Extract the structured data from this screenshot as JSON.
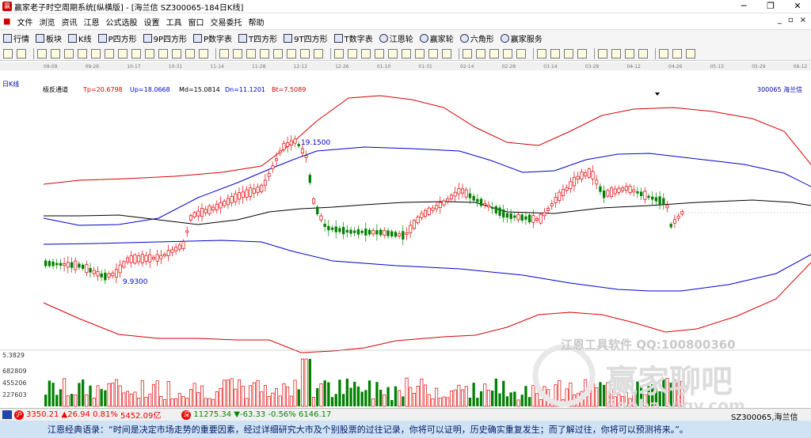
{
  "window": {
    "title": "赢家老子时空周期系统[纵横版] - [海兰信  SZ300065-184日K线]"
  },
  "menu": [
    "文件",
    "浏览",
    "资讯",
    "江恩",
    "公式选股",
    "设置",
    "工具",
    "窗口",
    "交易委托",
    "帮助"
  ],
  "toolbar1": [
    "行情",
    "板块",
    "K线",
    "P四方形",
    "9P四方形",
    "P数字表",
    "T四方形",
    "9T四方形",
    "T数字表",
    "江恩轮",
    "赢家轮",
    "六角形",
    "赢家服务"
  ],
  "chart": {
    "period_label": "日K线",
    "indicator": {
      "name": "极反通道",
      "tp": "Tp=20.6798",
      "up": "Up=18.0668",
      "md": "Md=15.0814",
      "dn": "Dn=11.1201",
      "bt": "Bt=7.5089"
    },
    "stock_label": "300065 海兰信",
    "high_label": "19.1500",
    "low_label": "9.9300",
    "watermark_line": "江恩工具软件 QQ:100800360",
    "watermark_big": "赢家聊吧",
    "watermark_url": "jiaoba.yjgy.com",
    "dates": [
      "09-09",
      "09-26",
      "10-17",
      "10-31",
      "11-14",
      "11-28",
      "12-12",
      "12-26",
      "01-10",
      "01-31",
      "02-14",
      "02-28",
      "03-14",
      "03-28",
      "04-12",
      "04-26",
      "05-15",
      "05-29",
      "06-12"
    ],
    "vol_axis": [
      "5.3829",
      "682809",
      "455206",
      "227603"
    ],
    "colors": {
      "up": "#e00000",
      "down": "#008000",
      "outer": "#d40000",
      "inner": "#0000cc",
      "mid": "#000000"
    },
    "chart_data": {
      "type": "candlestick",
      "channels": {
        "top": 20.6798,
        "upper": 18.0668,
        "middle": 15.0814,
        "lower": 11.1201,
        "bottom": 7.5089
      },
      "high": 19.15,
      "low": 9.93
    }
  },
  "status": {
    "sh": "3350.21",
    "sh_chg": "▲26.94",
    "sh_pct": "0.81%",
    "sh_amt": "5452.09亿",
    "sz": "11275.34",
    "sz_chg": "▼-63.33",
    "sz_pct": "-0.56%",
    "sz_amt": "6146.17",
    "stock": "SZ300065,海兰信"
  },
  "quote": "江恩经典语录：“时间是决定市场走势的重要因素，经过详细研究大市及个别股票的过往记录，你将可以证明，历史确实重复发生；而了解过往，你将可以预测将来。”。"
}
